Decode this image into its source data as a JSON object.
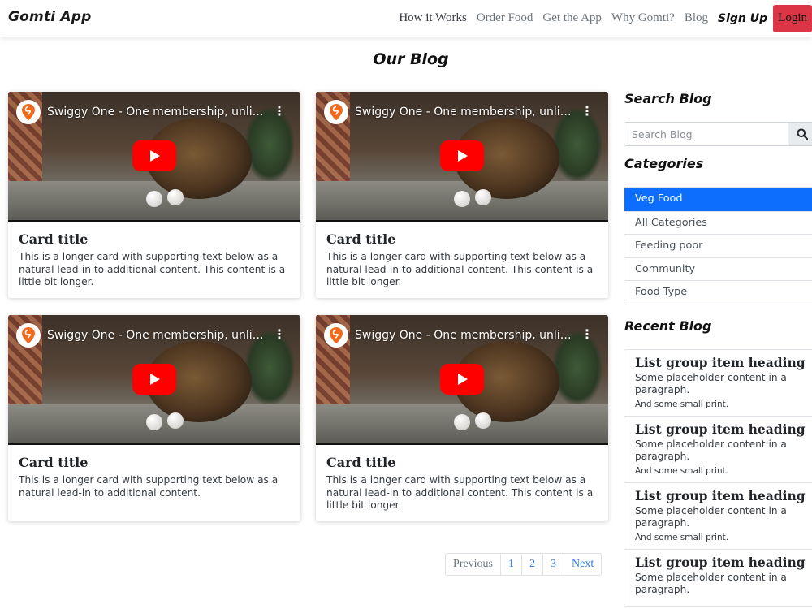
{
  "navbar": {
    "brand": "Gomti App",
    "links": [
      "How it Works",
      "Order Food",
      "Get the App",
      "Why Gomti?",
      "Blog"
    ],
    "signup": "Sign Up",
    "login": "Login"
  },
  "page_title": "Our Blog",
  "video": {
    "title": "Swiggy One - One membership, unlimite...",
    "logo_icon": "swiggy-logo-icon",
    "menu_icon": "more-vert-icon",
    "play_icon": "youtube-play-icon"
  },
  "cards": [
    {
      "title": "Card title",
      "text": "This is a longer card with supporting text below as a natural lead-in to additional content. This content is a little bit longer."
    },
    {
      "title": "Card title",
      "text": "This is a longer card with supporting text below as a natural lead-in to additional content. This content is a little bit longer."
    },
    {
      "title": "Card title",
      "text": "This is a longer card with supporting text below as a natural lead-in to additional content."
    },
    {
      "title": "Card title",
      "text": "This is a longer card with supporting text below as a natural lead-in to additional content. This content is a little bit longer."
    }
  ],
  "pagination": [
    "Previous",
    "1",
    "2",
    "3",
    "Next"
  ],
  "sidebar": {
    "search_heading": "Search Blog",
    "search_placeholder": "Search Blog",
    "categories_heading": "Categories",
    "categories": [
      "Veg Food",
      "All Categories",
      "Feeding poor",
      "Community",
      "Food Type"
    ],
    "recent_heading": "Recent Blog",
    "recent": [
      {
        "heading": "List group item heading",
        "text": "Some placeholder content in a paragraph.",
        "small": "And some small print."
      },
      {
        "heading": "List group item heading",
        "text": "Some placeholder content in a paragraph.",
        "small": "And some small print."
      },
      {
        "heading": "List group item heading",
        "text": "Some placeholder content in a paragraph.",
        "small": "And some small print."
      },
      {
        "heading": "List group item heading",
        "text": "Some placeholder content in a paragraph.",
        "small": ""
      }
    ]
  },
  "colors": {
    "login_button": "#dc3545",
    "active_category": "#0d6efd",
    "link": "#2c7be5",
    "youtube_red": "#ff0000"
  }
}
